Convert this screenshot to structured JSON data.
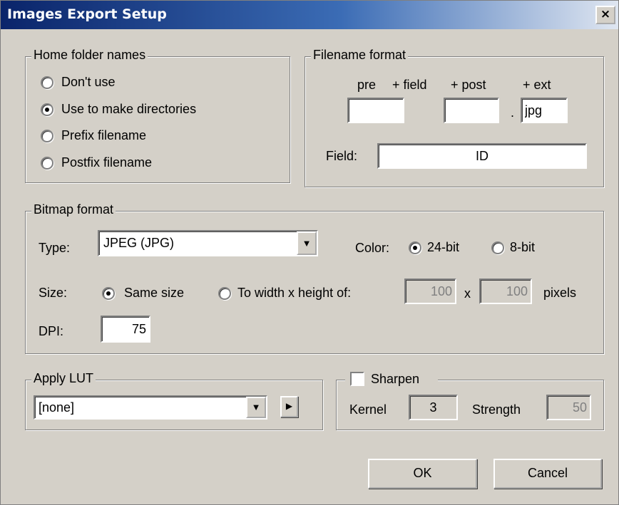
{
  "window": {
    "title": "Images Export Setup",
    "close_label": "×"
  },
  "home_folder": {
    "legend": "Home folder names",
    "options": [
      "Don't use",
      "Use to make directories",
      "Prefix filename",
      "Postfix filename"
    ],
    "selected": "Use to make directories"
  },
  "filename_format": {
    "legend": "Filename format",
    "pre_label": "pre",
    "field_label": "+ field",
    "post_label": "+ post",
    "ext_label": "+ ext",
    "pre_value": "",
    "post_value": "",
    "dot": ".",
    "ext_value": "jpg",
    "field_row_label": "Field:",
    "field_value": "ID"
  },
  "bitmap_format": {
    "legend": "Bitmap format",
    "type_label": "Type:",
    "type_value": "JPEG (JPG)",
    "color_label": "Color:",
    "color_options": [
      "24-bit",
      "8-bit"
    ],
    "color_selected": "24-bit",
    "size_label": "Size:",
    "size_options": [
      "Same size",
      "To width x height of:"
    ],
    "size_selected": "Same size",
    "width_value": "100",
    "x_label": "x",
    "height_value": "100",
    "pixels_label": "pixels",
    "dpi_label": "DPI:",
    "dpi_value": "75"
  },
  "apply_lut": {
    "legend": "Apply LUT",
    "value": "[none]",
    "arrow_glyph": "▼",
    "play_glyph": "▶"
  },
  "sharpen": {
    "label": "Sharpen",
    "checked": false,
    "kernel_label": "Kernel",
    "kernel_value": "3",
    "strength_label": "Strength",
    "strength_value": "50"
  },
  "buttons": {
    "ok": "OK",
    "cancel": "Cancel"
  },
  "colors": {
    "face": "#d4d0c8",
    "title_start": "#0a246a",
    "title_end": "#dfe6f1"
  }
}
